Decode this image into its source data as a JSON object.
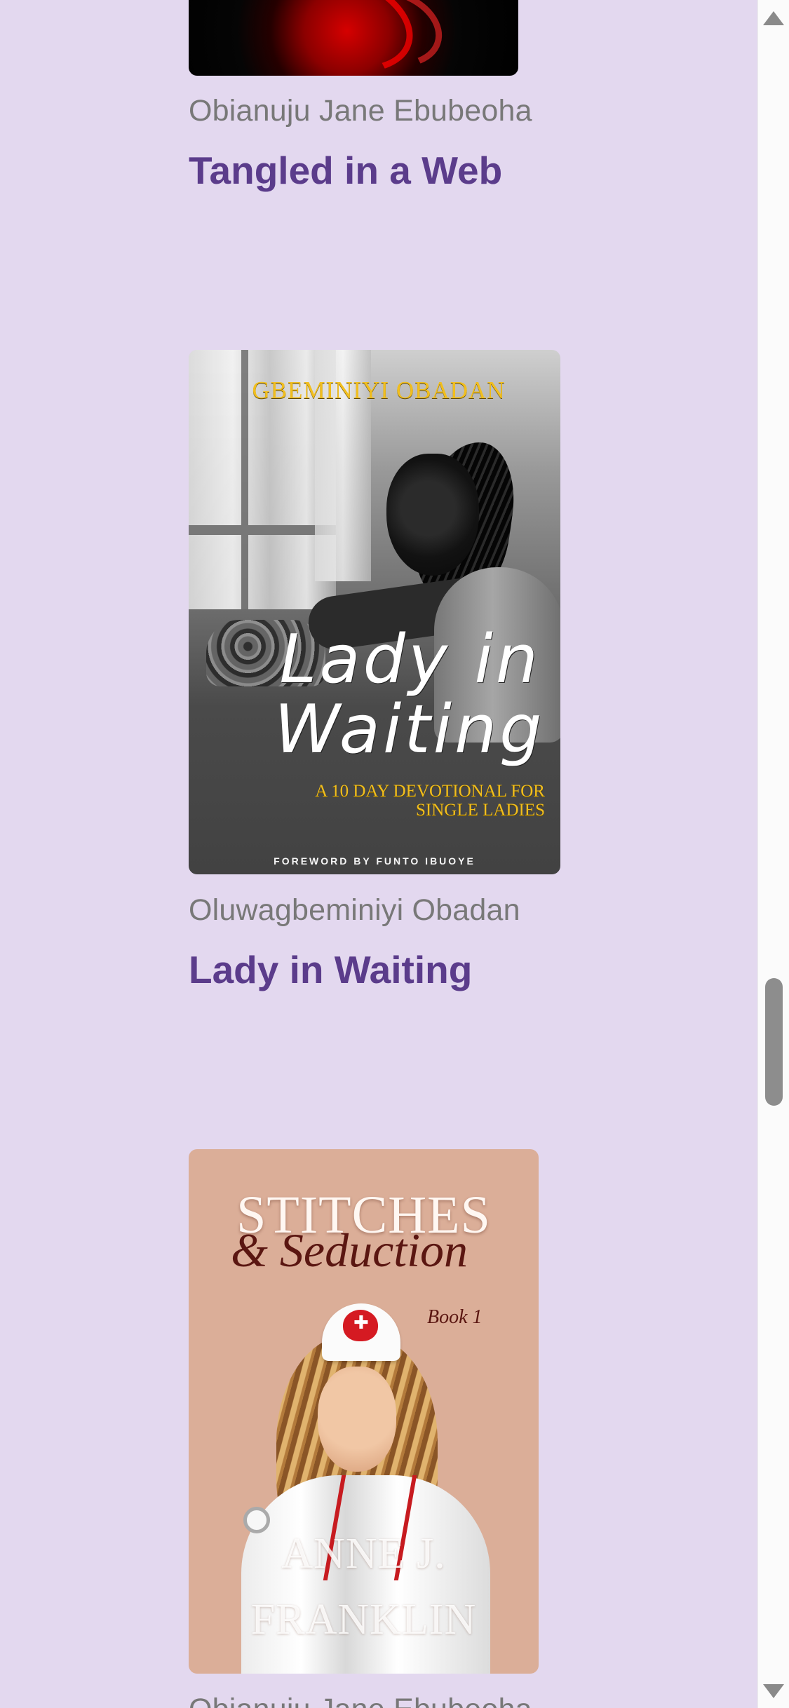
{
  "books": [
    {
      "author": "Obianuju Jane Ebubeoha",
      "title": "Tangled in a Web"
    },
    {
      "author": "Oluwagbeminiyi Obadan",
      "title": "Lady in Waiting",
      "cover": {
        "author": "GBEMINIYI OBADAN",
        "title": "Lady in Waiting",
        "subtitle": "A 10 DAY DEVOTIONAL FOR SINGLE LADIES",
        "foreword": "FOREWORD BY FUNTO IBUOYE"
      }
    },
    {
      "author": "Obianuju Jane Ebubeoha",
      "title": "Stitches & Seduction",
      "cover": {
        "title": "STITCHES",
        "subtitle": "& Seduction",
        "book": "Book 1",
        "author": "ANNE J.\nFRANKLIN"
      }
    }
  ],
  "colors": {
    "background": "#e3d8ef",
    "title": "#5b3c8b",
    "author": "#787878",
    "scrollbar": "#8d8d8d"
  },
  "icons": {
    "scroll_up": "triangle-up",
    "scroll_down": "triangle-down"
  }
}
